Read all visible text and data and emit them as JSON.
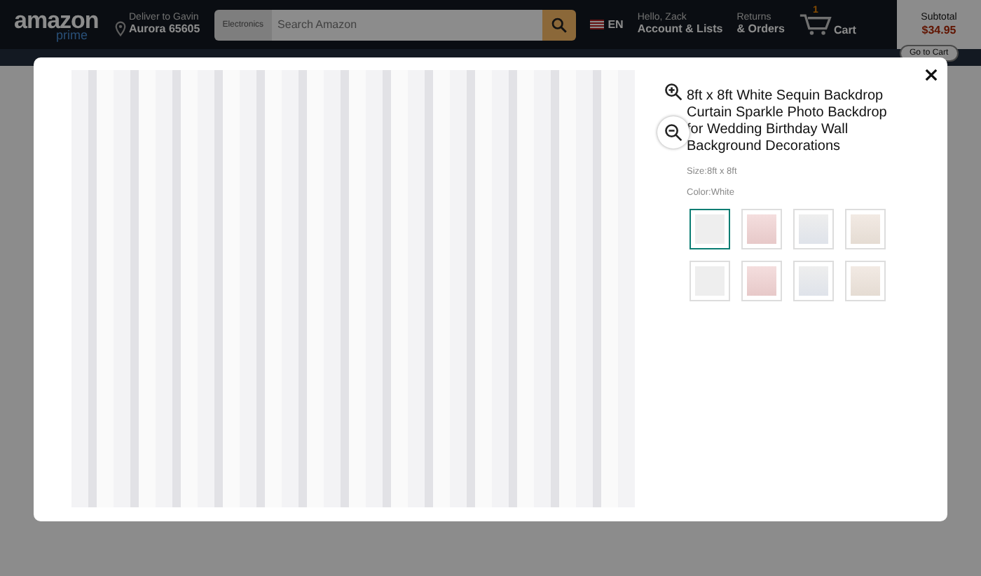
{
  "header": {
    "logo": "amazon",
    "logo_sub": "prime",
    "deliver_label": "Deliver to Gavin",
    "deliver_place": "Aurora 65605",
    "search_category": "Electronics",
    "search": {
      "placeholder": "Search Amazon"
    },
    "language": "EN",
    "greeting": "Hello, Zack",
    "account": "Account & Lists",
    "returns": "Returns",
    "orders": "& Orders",
    "cart_count": "1",
    "cart": "Cart"
  },
  "cart_panel": {
    "label": "Subtotal",
    "amount": "$34.95",
    "button": "Go to Cart"
  },
  "modal": {
    "title": "8ft x 8ft White Sequin Backdrop Curtain Sparkle Photo Backdrop for Wedding Birthday Wall Background Decorations",
    "size": "Size:8ft x 8ft",
    "color_label": "Color:White",
    "thumbnails": [
      {
        "selected": true
      },
      {
        "selected": false
      },
      {
        "selected": false
      },
      {
        "selected": false
      },
      {
        "selected": false
      },
      {
        "selected": false
      },
      {
        "selected": false
      },
      {
        "selected": false
      }
    ]
  }
}
